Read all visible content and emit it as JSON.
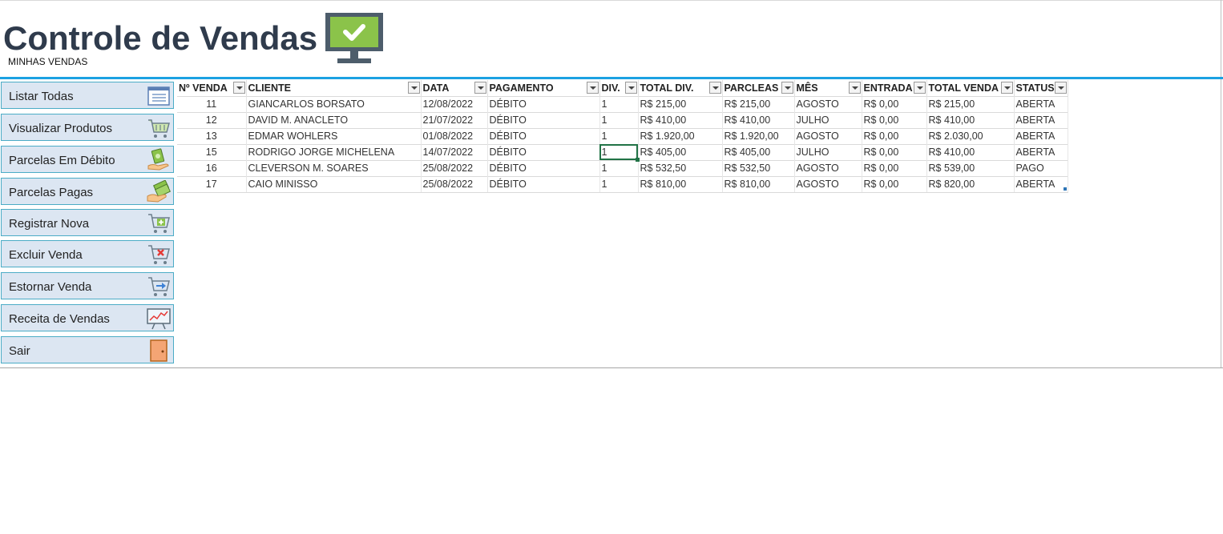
{
  "header": {
    "title": "Controle de Vendas",
    "subtitle": "MINHAS VENDAS",
    "monitor_color": "#8bc34a",
    "monitor_frame": "#4d5d6b"
  },
  "sidebar": {
    "items": [
      {
        "label": "Listar Todas",
        "icon": "list-icon"
      },
      {
        "label": "Visualizar Produtos",
        "icon": "basket-icon"
      },
      {
        "label": "Parcelas Em Débito",
        "icon": "money-hand-icon"
      },
      {
        "label": "Parcelas Pagas",
        "icon": "money-stack-icon"
      },
      {
        "label": "Registrar Nova",
        "icon": "cart-add-icon"
      },
      {
        "label": "Excluir Venda",
        "icon": "cart-remove-icon"
      },
      {
        "label": "Estornar Venda",
        "icon": "cart-return-icon"
      },
      {
        "label": "Receita de Vendas",
        "icon": "chart-board-icon"
      },
      {
        "label": "Sair",
        "icon": "door-icon"
      }
    ]
  },
  "table": {
    "columns": [
      "Nº VENDA",
      "CLIENTE",
      "DATA",
      "PAGAMENTO",
      "DIV.",
      "TOTAL DIV.",
      "PARCLEAS",
      "MÊS",
      "ENTRADA",
      "TOTAL VENDA",
      "STATUS"
    ],
    "rows": [
      [
        "11",
        "GIANCARLOS BORSATO",
        "12/08/2022",
        "DÉBITO",
        "1",
        "R$ 215,00",
        "R$ 215,00",
        "AGOSTO",
        "R$ 0,00",
        "R$ 215,00",
        "ABERTA"
      ],
      [
        "12",
        "DAVID M. ANACLETO",
        "21/07/2022",
        "DÉBITO",
        "1",
        "R$ 410,00",
        "R$ 410,00",
        "JULHO",
        "R$ 0,00",
        "R$ 410,00",
        "ABERTA"
      ],
      [
        "13",
        "EDMAR  WOHLERS",
        "01/08/2022",
        "DÉBITO",
        "1",
        "R$ 1.920,00",
        "R$ 1.920,00",
        "AGOSTO",
        "R$ 0,00",
        "R$ 2.030,00",
        "ABERTA"
      ],
      [
        "15",
        "RODRIGO JORGE  MICHELENA",
        "14/07/2022",
        "DÉBITO",
        "1",
        "R$ 405,00",
        "R$ 405,00",
        "JULHO",
        "R$ 0,00",
        "R$ 410,00",
        "ABERTA"
      ],
      [
        "16",
        "CLEVERSON M.  SOARES",
        "25/08/2022",
        "DÉBITO",
        "1",
        "R$ 532,50",
        "R$ 532,50",
        "AGOSTO",
        "R$ 0,00",
        "R$ 539,00",
        "PAGO"
      ],
      [
        "17",
        "CAIO  MINISSO",
        "25/08/2022",
        "DÉBITO",
        "1",
        "R$ 810,00",
        "R$ 810,00",
        "AGOSTO",
        "R$ 0,00",
        "R$ 820,00",
        "ABERTA"
      ]
    ],
    "selected_cell": {
      "row": 3,
      "col": 4
    }
  },
  "colors": {
    "accent_bar": "#1ba1e2",
    "button_bg": "#dce6f2",
    "button_border": "#4bacc6",
    "title": "#2f3b4c",
    "selection": "#217346"
  }
}
